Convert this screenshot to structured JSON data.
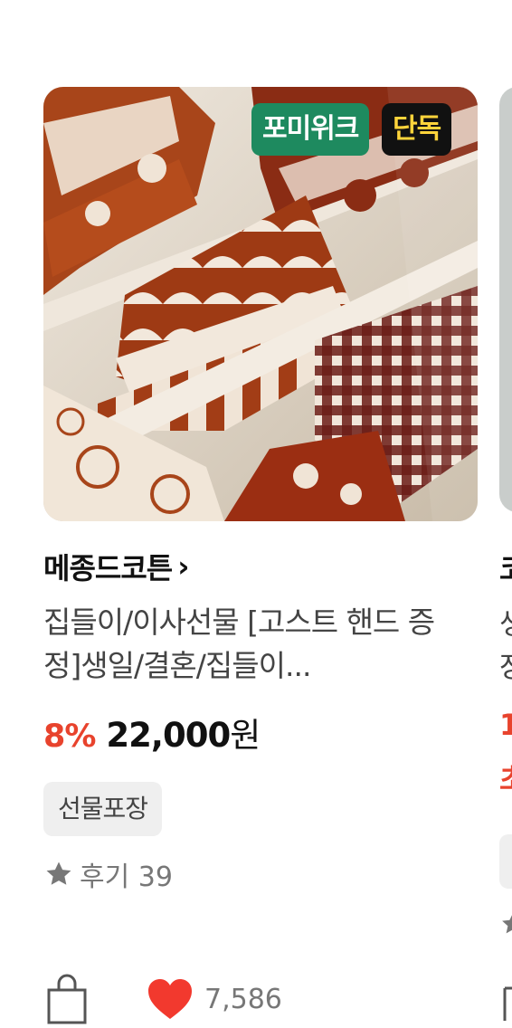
{
  "product": {
    "badge_primary": "포미위크",
    "badge_secondary": "단독",
    "brand": "메종드코튼",
    "brand_chevron": "›",
    "title": "집들이/이사선물 [고스트 핸드 증정]생일/결혼/집들이...",
    "discount": "8%",
    "price": "22,000",
    "currency": "원",
    "tag": "선물포장",
    "review_label": "후기 39",
    "like_count": "7,586"
  },
  "next_product": {
    "brand_partial": "코",
    "title_line1_partial": "생",
    "title_line2_partial": "장",
    "price_partial": "1",
    "extra_partial": "초"
  },
  "colors": {
    "badge_green": "#1e8a5f",
    "badge_black": "#111111",
    "badge_yellow_text": "#ffd43b",
    "discount_red": "#e8432d",
    "heart_red": "#f2392e",
    "muted_gray": "#777777"
  },
  "icons": {
    "star": "star-icon",
    "bag": "shopping-bag-icon",
    "heart": "heart-icon",
    "chevron": "chevron-right-icon"
  }
}
